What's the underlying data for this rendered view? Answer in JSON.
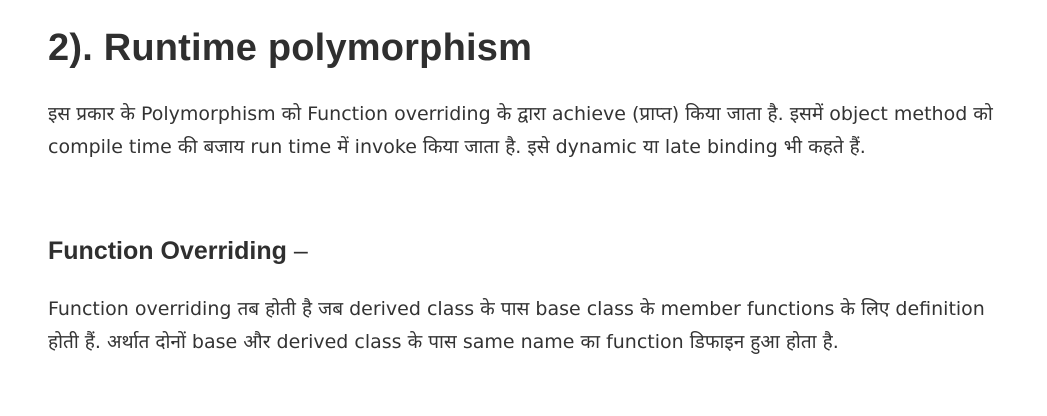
{
  "section": {
    "heading": "2). Runtime polymorphism",
    "intro": "इस प्रकार के Polymorphism को Function overriding के द्वारा achieve (प्राप्त) किया जाता है. इसमें object method को compile time की बजाय run time में invoke किया जाता है. इसे dynamic या late binding भी कहते हैं."
  },
  "subsection": {
    "heading": "Function Overriding",
    "separator": " –",
    "body": "Function overriding तब होती है जब derived class के पास base class के member functions के लिए definition होती हैं. अर्थात दोनों base और derived class के पास same name का function डिफाइन हुआ होता है."
  }
}
